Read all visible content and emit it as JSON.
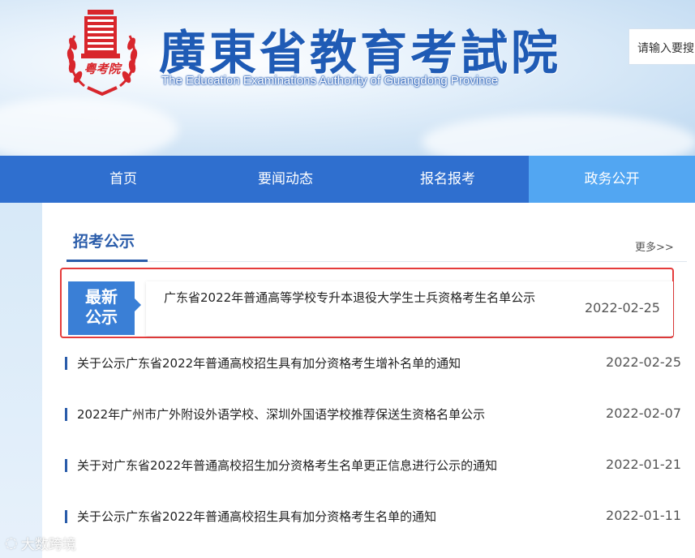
{
  "header": {
    "logo_text": "粤考院",
    "title_cn": "廣東省教育考試院",
    "title_en": "The Education Examinations Authority of Guangdong Province",
    "search_placeholder": "请输入要搜"
  },
  "nav": {
    "items": [
      {
        "label": "首页"
      },
      {
        "label": "要闻动态"
      },
      {
        "label": "报名报考"
      },
      {
        "label": "政务公开"
      }
    ],
    "active_index": 3
  },
  "section": {
    "title": "招考公示",
    "more_label": "更多>>"
  },
  "featured": {
    "badge_line1": "最新",
    "badge_line2": "公示",
    "title": "广东省2022年普通高等学校专升本退役大学生士兵资格考生名单公示",
    "date": "2022-02-25"
  },
  "news": [
    {
      "title": "关于公示广东省2022年普通高校招生具有加分资格考生增补名单的通知",
      "date": "2022-02-25"
    },
    {
      "title": "2022年广州市广外附设外语学校、深圳外国语学校推荐保送生资格名单公示",
      "date": "2022-02-07"
    },
    {
      "title": "关于对广东省2022年普通高校招生加分资格考生名单更正信息进行公示的通知",
      "date": "2022-01-21"
    },
    {
      "title": "关于公示广东省2022年普通高校招生具有加分资格考生名单的通知",
      "date": "2022-01-11"
    }
  ],
  "watermark": "大数跨境",
  "colors": {
    "nav_bg": "#2f6fcf",
    "nav_active": "#52a6f2",
    "brand_blue": "#2a5caa",
    "highlight_border": "#e53b3b",
    "logo_red": "#d8262c"
  }
}
